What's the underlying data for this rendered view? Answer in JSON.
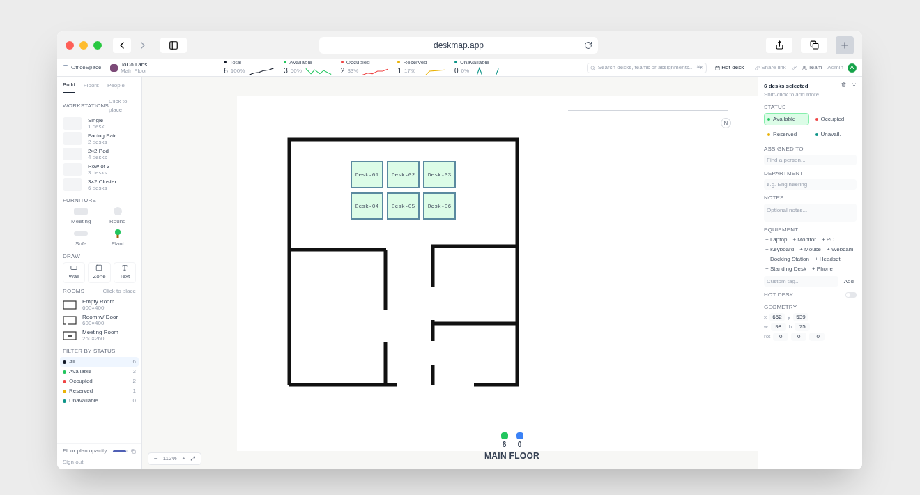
{
  "browser": {
    "url": "deskmap.app"
  },
  "header": {
    "brand": "OfficeSpace",
    "org": {
      "name": "JoDo Labs",
      "subtitle": "Main Floor"
    },
    "stats": [
      {
        "label": "Total",
        "value": "6",
        "percent": "100%",
        "color": "#111827"
      },
      {
        "label": "Available",
        "value": "3",
        "percent": "50%",
        "color": "#22c55e"
      },
      {
        "label": "Occupied",
        "value": "2",
        "percent": "33%",
        "color": "#ef4444"
      },
      {
        "label": "Reserved",
        "value": "1",
        "percent": "17%",
        "color": "#eab308"
      },
      {
        "label": "Unavailable",
        "value": "0",
        "percent": "0%",
        "color": "#0d9488"
      }
    ],
    "search": {
      "placeholder": "Search desks, teams or assignments...",
      "shortcut": "⌘K"
    },
    "actions": [
      "Hot-desk",
      "Share link"
    ],
    "team": "Team",
    "user": "Admin",
    "avatar": "A"
  },
  "sidebar": {
    "tabs": [
      {
        "label": "Build",
        "selected": true
      },
      {
        "label": "Floors",
        "selected": false
      },
      {
        "label": "People",
        "selected": false
      }
    ],
    "workstations": {
      "title": "WORKSTATIONS",
      "hint": "Click to place",
      "items": [
        {
          "name": "Single",
          "count": "1 desk"
        },
        {
          "name": "Facing Pair",
          "count": "2 desks"
        },
        {
          "name": "2×2 Pod",
          "count": "4 desks"
        },
        {
          "name": "Row of 3",
          "count": "3 desks"
        },
        {
          "name": "3×2 Cluster",
          "count": "6 desks"
        }
      ]
    },
    "furniture": {
      "title": "FURNITURE",
      "items": [
        {
          "label": "Meeting",
          "kind": "table"
        },
        {
          "label": "Round",
          "kind": "round"
        },
        {
          "label": "Sofa",
          "kind": "sofa"
        },
        {
          "label": "Plant",
          "kind": "plant"
        }
      ]
    },
    "draw": {
      "title": "DRAW",
      "items": [
        {
          "label": "Wall",
          "kind": "wall"
        },
        {
          "label": "Zone",
          "kind": "zone"
        },
        {
          "label": "Text",
          "kind": "text"
        }
      ]
    },
    "rooms": {
      "title": "ROOMS",
      "hint": "Click to place",
      "items": [
        {
          "name": "Empty Room",
          "size": "600×400",
          "kind": "empty"
        },
        {
          "name": "Room w/ Door",
          "size": "600×400",
          "kind": "door"
        },
        {
          "name": "Meeting Room",
          "size": "260×260",
          "kind": "meeting"
        }
      ]
    },
    "filter": {
      "title": "FILTER BY STATUS",
      "items": [
        {
          "label": "All",
          "count": "6",
          "color": "#111827",
          "selected": true
        },
        {
          "label": "Available",
          "count": "3",
          "color": "#22c55e",
          "selected": false
        },
        {
          "label": "Occupied",
          "count": "2",
          "color": "#ef4444",
          "selected": false
        },
        {
          "label": "Reserved",
          "count": "1",
          "color": "#eab308",
          "selected": false
        },
        {
          "label": "Unavailable",
          "count": "0",
          "color": "#0d9488",
          "selected": false
        }
      ]
    },
    "opacity": {
      "label": "Floor plan opacity",
      "level": 0.85
    },
    "sign_out": "Sign out"
  },
  "canvas": {
    "zoom": {
      "minus": "−",
      "value": "112%",
      "plus": "+",
      "fit": "⤢"
    },
    "compass": "N",
    "desks": [
      {
        "label": "Desk-01",
        "selected": true
      },
      {
        "label": "Desk-02",
        "selected": true
      },
      {
        "label": "Desk-03",
        "selected": true
      },
      {
        "label": "Desk-04",
        "selected": true
      },
      {
        "label": "Desk-05",
        "selected": true
      },
      {
        "label": "Desk-06",
        "selected": true
      }
    ],
    "legend": [
      {
        "count": "6",
        "color": "#22c55e"
      },
      {
        "count": "0",
        "color": "#3b82f6"
      }
    ],
    "floor_name": "MAIN FLOOR"
  },
  "panel": {
    "title": "6 desks selected",
    "subtitle": "Shift-click to add more",
    "status": {
      "title": "STATUS",
      "options": [
        {
          "label": "Available",
          "color": "#22c55e",
          "selected": true
        },
        {
          "label": "Occupied",
          "color": "#ef4444",
          "selected": false
        },
        {
          "label": "Reserved",
          "color": "#eab308",
          "selected": false
        },
        {
          "label": "Unavail.",
          "color": "#0d9488",
          "selected": false
        }
      ]
    },
    "assigned": {
      "title": "ASSIGNED TO",
      "placeholder": "Find a person..."
    },
    "department": {
      "title": "DEPARTMENT",
      "placeholder": "e.g. Engineering"
    },
    "notes": {
      "title": "NOTES",
      "placeholder": "Optional notes..."
    },
    "equipment": {
      "title": "EQUIPMENT",
      "tags": [
        "+ Laptop",
        "+ Monitor",
        "+ PC",
        "+ Keyboard",
        "+ Mouse",
        "+ Webcam",
        "+ Docking Station",
        "+ Headset",
        "+ Standing Desk",
        "+ Phone"
      ],
      "placeholder": "Custom tag...",
      "add": "Add"
    },
    "hot_desk": {
      "title": "HOT DESK",
      "on": false
    },
    "geometry": {
      "title": "GEOMETRY",
      "rows": [
        {
          "fields": [
            {
              "label": "x",
              "value": "652"
            },
            {
              "label": "y",
              "value": "539"
            }
          ]
        },
        {
          "fields": [
            {
              "label": "w",
              "value": "98"
            },
            {
              "label": "h",
              "value": "75"
            }
          ]
        },
        {
          "fields": [
            {
              "label": "rot",
              "value": "0"
            },
            {
              "value": "0"
            },
            {
              "value": "-0"
            }
          ]
        }
      ]
    }
  }
}
